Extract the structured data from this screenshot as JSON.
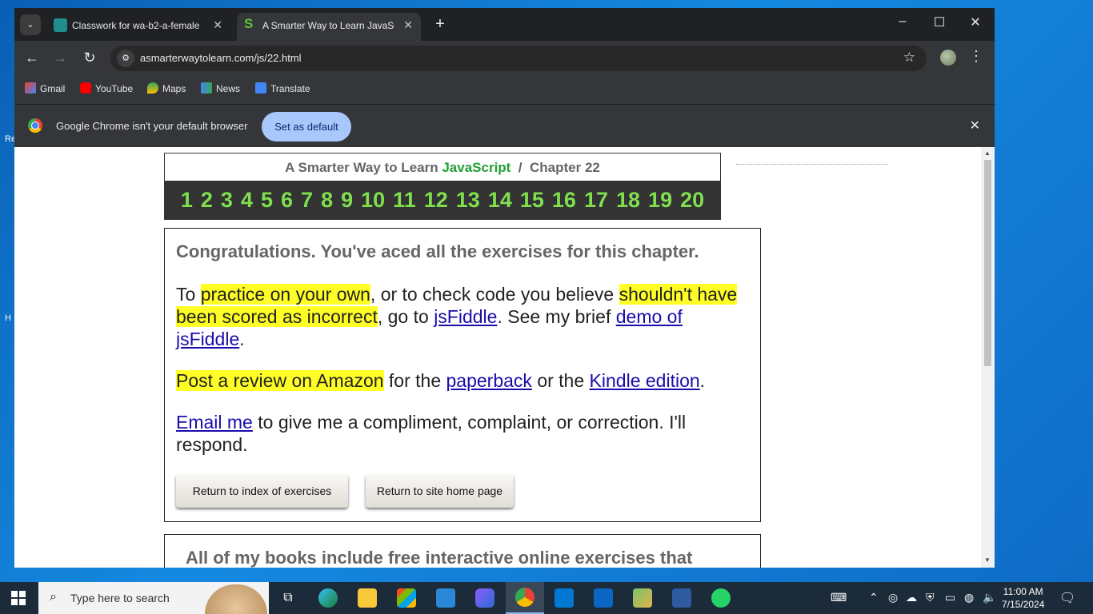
{
  "browser": {
    "tabs": [
      {
        "title": "Classwork for wa-b2-a-female",
        "active": false
      },
      {
        "title": "A Smarter Way to Learn JavaScr",
        "active": true
      }
    ],
    "url": "asmarterwaytolearn.com/js/22.html",
    "bookmarks": [
      "Gmail",
      "YouTube",
      "Maps",
      "News",
      "Translate"
    ],
    "infobar": {
      "text": "Google Chrome isn't your default browser",
      "button": "Set as default"
    }
  },
  "page": {
    "header": {
      "title_prefix": "A Smarter Way to Learn",
      "title_brand": "JavaScript",
      "separator": "/",
      "chapter": "Chapter 22"
    },
    "chapters": [
      "1",
      "2",
      "3",
      "4",
      "5",
      "6",
      "7",
      "8",
      "9",
      "10",
      "11",
      "12",
      "13",
      "14",
      "15",
      "16",
      "17",
      "18",
      "19",
      "20"
    ],
    "congrats": "Congratulations. You've aced all the exercises for this chapter.",
    "p1": {
      "t1": "To ",
      "h1": "practice on your own",
      "t2": ", or to check code you believe ",
      "h2": "shouldn't have been scored as incorrect",
      "t3": ", go to ",
      "l1": "jsFiddle",
      "t4": ". See my brief ",
      "l2": "demo of jsFiddle",
      "t5": "."
    },
    "p2": {
      "h1": "Post a review on Amazon",
      "t1": " for the ",
      "l1": "paperback",
      "t2": " or the ",
      "l2": "Kindle edition",
      "t3": "."
    },
    "p3": {
      "l1": "Email me",
      "t1": " to give me a compliment, complaint, or correction. I'll respond."
    },
    "buttons": {
      "index": "Return to index of exercises",
      "home": "Return to site home page"
    },
    "books_text": "All of my books include free interactive online exercises that"
  },
  "taskbar": {
    "search_placeholder": "Type here to search",
    "time": "11:00 AM",
    "date": "7/15/2024"
  },
  "desktop": {
    "labels": [
      "Re",
      "H"
    ]
  }
}
